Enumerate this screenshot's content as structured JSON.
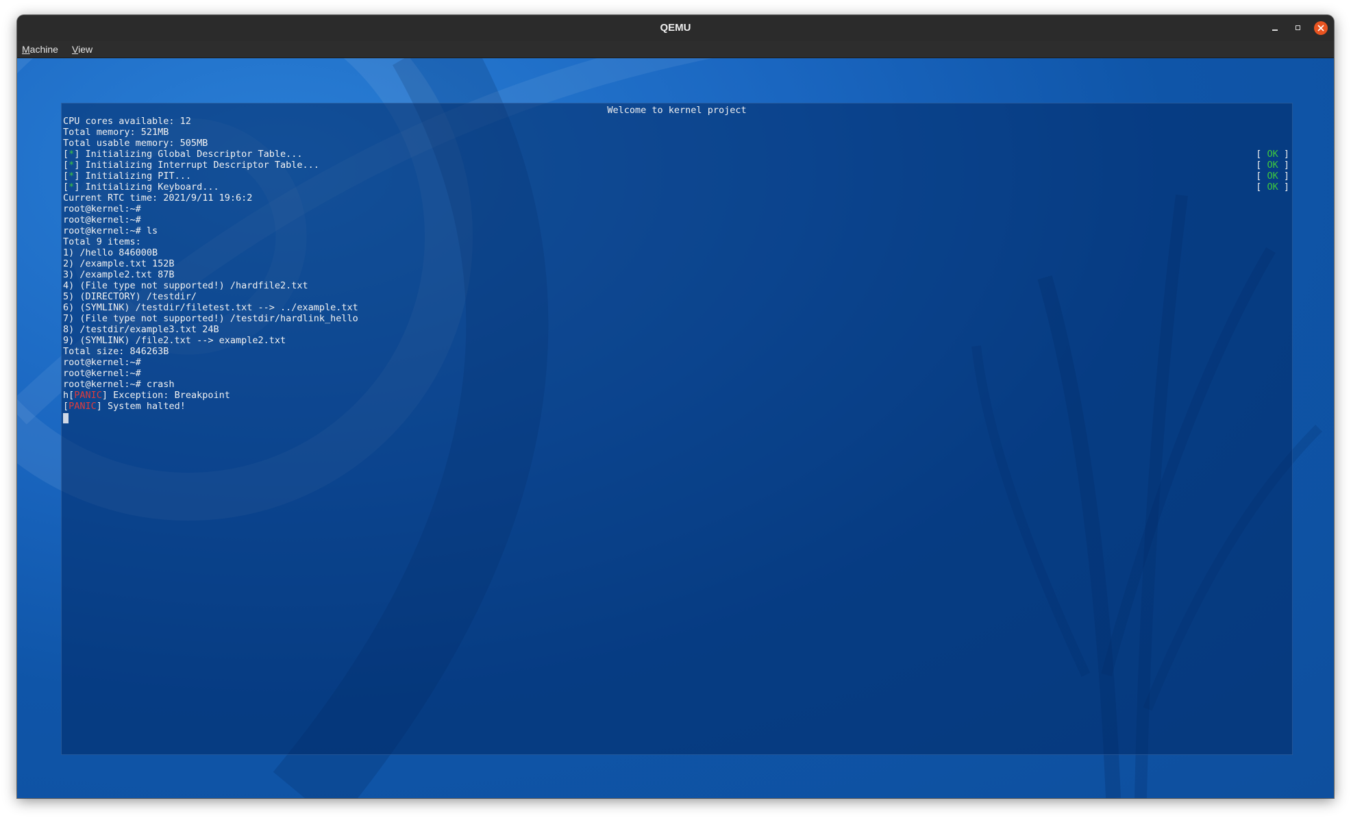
{
  "window": {
    "title": "QEMU",
    "buttons": {
      "minimize": "minimize-icon",
      "maximize": "maximize-icon",
      "close": "close-icon"
    }
  },
  "menubar": {
    "items": [
      {
        "accel": "M",
        "rest": "achine"
      },
      {
        "accel": "V",
        "rest": "iew"
      }
    ]
  },
  "console": {
    "welcome": "Welcome to kernel project",
    "lines": [
      "CPU cores available: 12",
      "Total memory: 521MB",
      "Total usable memory: 505MB"
    ],
    "init_steps": [
      {
        "open": "[",
        "star": "*",
        "close": "]",
        "text": " Initializing Global Descriptor Table...",
        "ok_open": "[ ",
        "ok": "OK",
        "ok_close": " ]"
      },
      {
        "open": "[",
        "star": "*",
        "close": "]",
        "text": " Initializing Interrupt Descriptor Table...",
        "ok_open": "[ ",
        "ok": "OK",
        "ok_close": " ]"
      },
      {
        "open": "[",
        "star": "*",
        "close": "]",
        "text": " Initializing PIT...",
        "ok_open": "[ ",
        "ok": "OK",
        "ok_close": " ]"
      },
      {
        "open": "[",
        "star": "*",
        "close": "]",
        "text": " Initializing Keyboard...",
        "ok_open": "[ ",
        "ok": "OK",
        "ok_close": " ]"
      }
    ],
    "after": [
      "Current RTC time: 2021/9/11 19:6:2",
      "root@kernel:~#",
      "root@kernel:~#",
      "root@kernel:~# ls",
      "Total 9 items:",
      "1) /hello 846000B",
      "2) /example.txt 152B",
      "3) /example2.txt 87B",
      "4) (File type not supported!) /hardfile2.txt",
      "5) (DIRECTORY) /testdir/",
      "6) (SYMLINK) /testdir/filetest.txt --> ../example.txt",
      "7) (File type not supported!) /testdir/hardlink_hello",
      "8) /testdir/example3.txt 24B",
      "9) (SYMLINK) /file2.txt --> example2.txt",
      "Total size: 846263B",
      "root@kernel:~#",
      "root@kernel:~#",
      "root@kernel:~# crash"
    ],
    "panic1": {
      "pre": "h[",
      "tag": "PANIC",
      "post": "] Exception: Breakpoint"
    },
    "panic2": {
      "pre": "[",
      "tag": "PANIC",
      "post": "] System halted!"
    }
  },
  "colors": {
    "desktop": "#0f55a8",
    "ok_green": "#3ec73e",
    "panic_red": "#e03c3c",
    "close_button": "#e95420"
  }
}
